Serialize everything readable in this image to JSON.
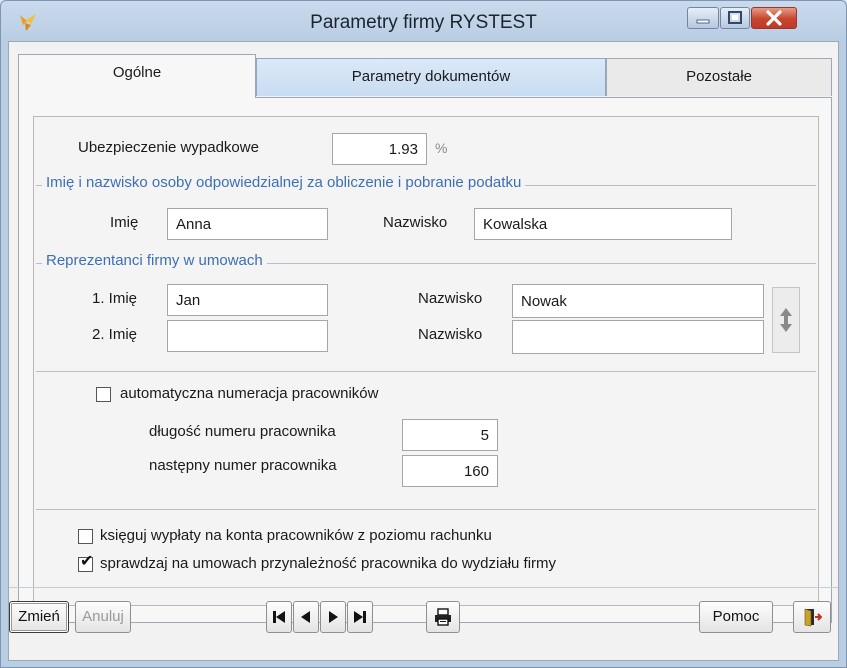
{
  "window": {
    "title": "Parametry firmy RYSTEST",
    "controls": [
      "minimize-icon",
      "maximize-icon",
      "close-icon"
    ]
  },
  "tabs": [
    {
      "label": "Ogólne",
      "active": true
    },
    {
      "label": "Parametry dokumentów",
      "active": false
    },
    {
      "label": "Pozostałe",
      "active": false
    }
  ],
  "general": {
    "accident_insurance": {
      "label": "Ubezpieczenie wypadkowe",
      "value": "1.93",
      "unit": "%"
    },
    "tax_person": {
      "group_label": "Imię i nazwisko osoby odpowiedzialnej za obliczenie i pobranie podatku",
      "first_name_label": "Imię",
      "first_name": "Anna",
      "last_name_label": "Nazwisko",
      "last_name": "Kowalska"
    },
    "representatives": {
      "group_label": "Reprezentanci firmy w umowach",
      "rows": [
        {
          "first_label": "1. Imię",
          "first": "Jan",
          "last_label": "Nazwisko",
          "last": "Nowak"
        },
        {
          "first_label": "2. Imię",
          "first": "",
          "last_label": "Nazwisko",
          "last": ""
        }
      ]
    },
    "numbering": {
      "auto_label": "automatyczna numeracja pracowników",
      "auto_checked": false,
      "length_label": "długość numeru pracownika",
      "length_value": "5",
      "next_label": "następny numer pracownika",
      "next_value": "160"
    },
    "options": [
      {
        "label": "księguj wypłaty na konta pracowników z poziomu rachunku",
        "checked": false
      },
      {
        "label": "sprawdzaj na umowach przynależność pracownika do wydziału firmy",
        "checked": true
      }
    ]
  },
  "footer": {
    "change_label": "Zmień",
    "cancel_label": "Anuluj",
    "nav_icons": [
      "first-record-icon",
      "prev-record-icon",
      "next-record-icon",
      "last-record-icon"
    ],
    "print_icon": "printer-icon",
    "help_label": "Pomoc",
    "exit_icon": "exit-door-icon"
  },
  "colors": {
    "group_label": "#3d6fb5",
    "title_bar": "#c9daec",
    "close_button": "#c7452d"
  }
}
